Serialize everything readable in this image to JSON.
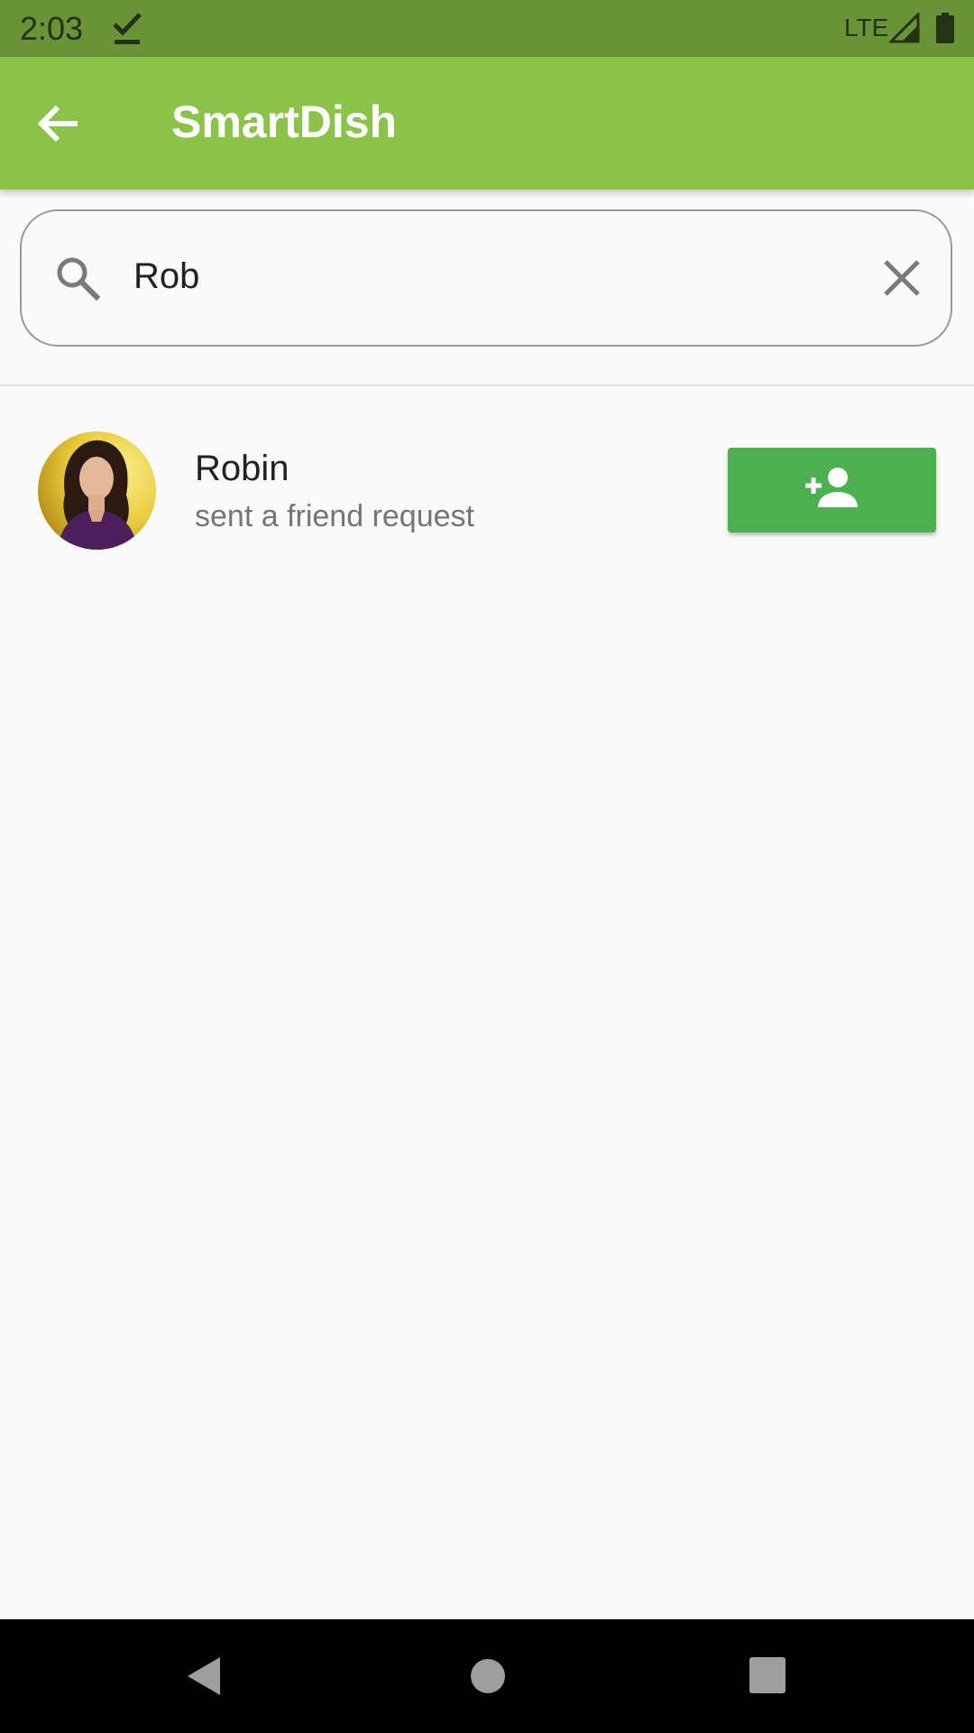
{
  "status_bar": {
    "time": "2:03",
    "network": "LTE",
    "icons": [
      "download-done-icon",
      "signal-icon",
      "battery-icon"
    ]
  },
  "app_bar": {
    "title": "SmartDish",
    "back_icon": "arrow-back-icon",
    "background": "#8bc34a"
  },
  "search": {
    "value": "Rob",
    "search_icon": "search-icon",
    "clear_icon": "close-icon"
  },
  "results": [
    {
      "name": "Robin",
      "subtitle": "sent a friend request",
      "avatar": "profile-photo",
      "action_icon": "person-add-icon",
      "action_color": "#4caf50"
    }
  ],
  "nav_bar": {
    "icons": [
      "nav-back-icon",
      "nav-home-icon",
      "nav-recents-icon"
    ]
  }
}
